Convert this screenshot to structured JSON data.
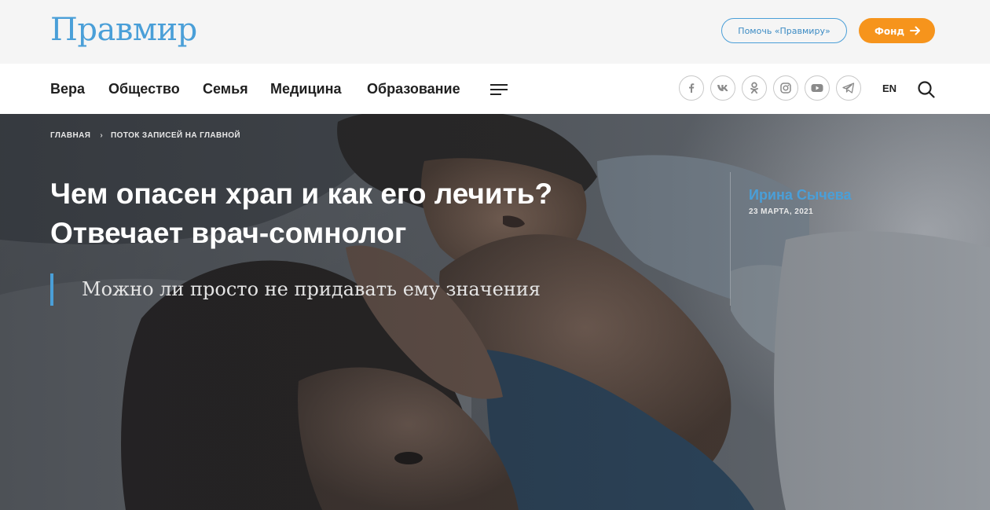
{
  "header": {
    "logo": "Правмир",
    "help_button": "Помочь «Правмиру»",
    "fund_button": "Фонд"
  },
  "nav": {
    "items": [
      "Вера",
      "Общество",
      "Семья",
      "Медицина",
      "Образование"
    ],
    "social": [
      "facebook-icon",
      "vk-icon",
      "odnoklassniki-icon",
      "instagram-icon",
      "youtube-icon",
      "telegram-icon"
    ],
    "lang": "EN"
  },
  "breadcrumbs": {
    "home": "ГЛАВНАЯ",
    "separator": "›",
    "section": "ПОТОК ЗАПИСЕЙ НА ГЛАВНОЙ"
  },
  "article": {
    "title": "Чем опасен храп и как его лечить? Отвечает врач-сомнолог",
    "lead": "Можно ли просто не придавать ему значения",
    "author": "Ирина Сычева",
    "date": "23 МАРТА, 2021"
  },
  "colors": {
    "brand_blue": "#4a9fd8",
    "accent_orange": "#f6941c"
  }
}
